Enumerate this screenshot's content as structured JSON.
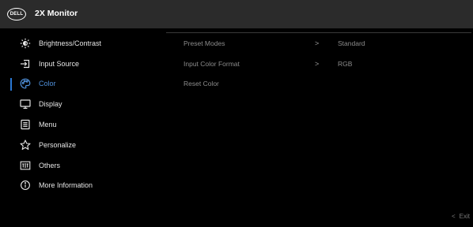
{
  "header": {
    "logo_text": "DELL",
    "title": "2X Monitor"
  },
  "menu": {
    "items": [
      {
        "label": "Brightness/Contrast",
        "icon": "brightness-icon"
      },
      {
        "label": "Input Source",
        "icon": "input-source-icon"
      },
      {
        "label": "Color",
        "icon": "color-palette-icon",
        "selected": true
      },
      {
        "label": "Display",
        "icon": "display-icon"
      },
      {
        "label": "Menu",
        "icon": "menu-icon"
      },
      {
        "label": "Personalize",
        "icon": "star-icon"
      },
      {
        "label": "Others",
        "icon": "others-icon"
      },
      {
        "label": "More Information",
        "icon": "info-icon"
      }
    ]
  },
  "submenu": {
    "rows": [
      {
        "label": "Preset Modes",
        "arrow": ">",
        "value": "Standard"
      },
      {
        "label": "Input Color Format",
        "arrow": ">",
        "value": "RGB"
      },
      {
        "label": "Reset Color"
      }
    ]
  },
  "footer": {
    "exit_label": "Exit",
    "exit_arrow": "<"
  },
  "colors": {
    "accent": "#2a78d4",
    "header_bg": "#2b2b2b"
  }
}
